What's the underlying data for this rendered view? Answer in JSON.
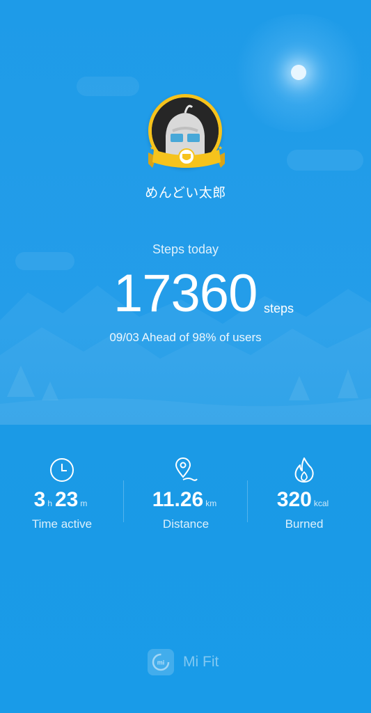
{
  "profile": {
    "username": "めんどい太郎"
  },
  "steps": {
    "title": "Steps today",
    "value": "17360",
    "unit": "steps",
    "rank_text": "09/03 Ahead of 98% of users"
  },
  "stats": [
    {
      "icon": "clock-icon",
      "hours": "3",
      "hours_unit": "h",
      "minutes": "23",
      "minutes_unit": "m",
      "label": "Time active"
    },
    {
      "icon": "location-pin-icon",
      "value": "11.26",
      "unit": "km",
      "label": "Distance"
    },
    {
      "icon": "flame-icon",
      "value": "320",
      "unit": "kcal",
      "label": "Burned"
    }
  ],
  "brand": {
    "name": "Mi Fit",
    "logo_text": "mi"
  },
  "colors": {
    "background": "#1e9be8",
    "badge_gold": "#f6c31c"
  }
}
